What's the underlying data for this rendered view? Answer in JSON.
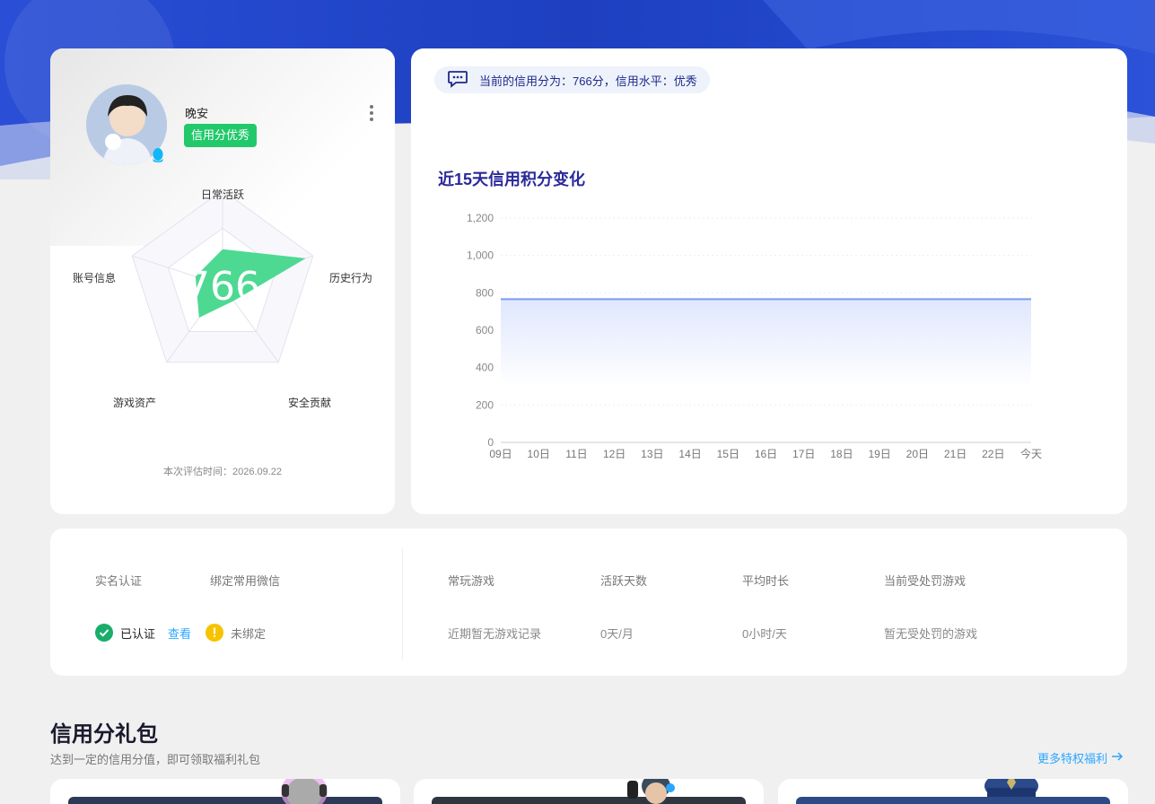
{
  "profile": {
    "username": "晚安",
    "badge": "信用分优秀",
    "score": "766",
    "radar_labels": {
      "daily_active": "日常活跃",
      "history": "历史行为",
      "security": "安全贡献",
      "assets": "游戏资产",
      "account": "账号信息"
    },
    "radar_values": [
      0.38,
      0.92,
      0.2,
      0.42,
      0.3
    ],
    "eval_time": "本次评估时间：2026.09.22"
  },
  "score_tip": "当前的信用分为：766分，信用水平：优秀",
  "chart_title": "近15天信用积分变化",
  "chart_data": {
    "type": "area",
    "title": "近15天信用积分变化",
    "categories": [
      "09日",
      "10日",
      "11日",
      "12日",
      "13日",
      "14日",
      "15日",
      "16日",
      "17日",
      "18日",
      "19日",
      "20日",
      "21日",
      "22日",
      "今天"
    ],
    "series": [
      {
        "values": [
          766,
          766,
          766,
          766,
          766,
          766,
          766,
          766,
          766,
          766,
          766,
          766,
          766,
          766,
          766
        ]
      }
    ],
    "yticks": [
      "0",
      "200",
      "400",
      "600",
      "800",
      "1,000",
      "1,200"
    ],
    "ylim": [
      0,
      1200
    ],
    "grid": true,
    "color": "#7a9cf0"
  },
  "info": {
    "real_name_label": "实名认证",
    "wechat_label": "绑定常用微信",
    "verified_text": "已认证",
    "view_link": "查看",
    "unbound_text": "未绑定",
    "frequent_game_label": "常玩游戏",
    "frequent_game_value": "近期暂无游戏记录",
    "active_days_label": "活跃天数",
    "active_days_value": "0天/月",
    "avg_time_label": "平均时长",
    "avg_time_value": "0小时/天",
    "punished_label": "当前受处罚游戏",
    "punished_value": "暂无受处罚的游戏"
  },
  "gift_section": {
    "title": "信用分礼包",
    "subtitle": "达到一定的信用分值，即可领取福利礼包",
    "more_link": "更多特权福利"
  },
  "colors": {
    "accent_green": "#22c96b",
    "hero_blue": "#1e46c8",
    "link_blue": "#2ba6ff"
  }
}
